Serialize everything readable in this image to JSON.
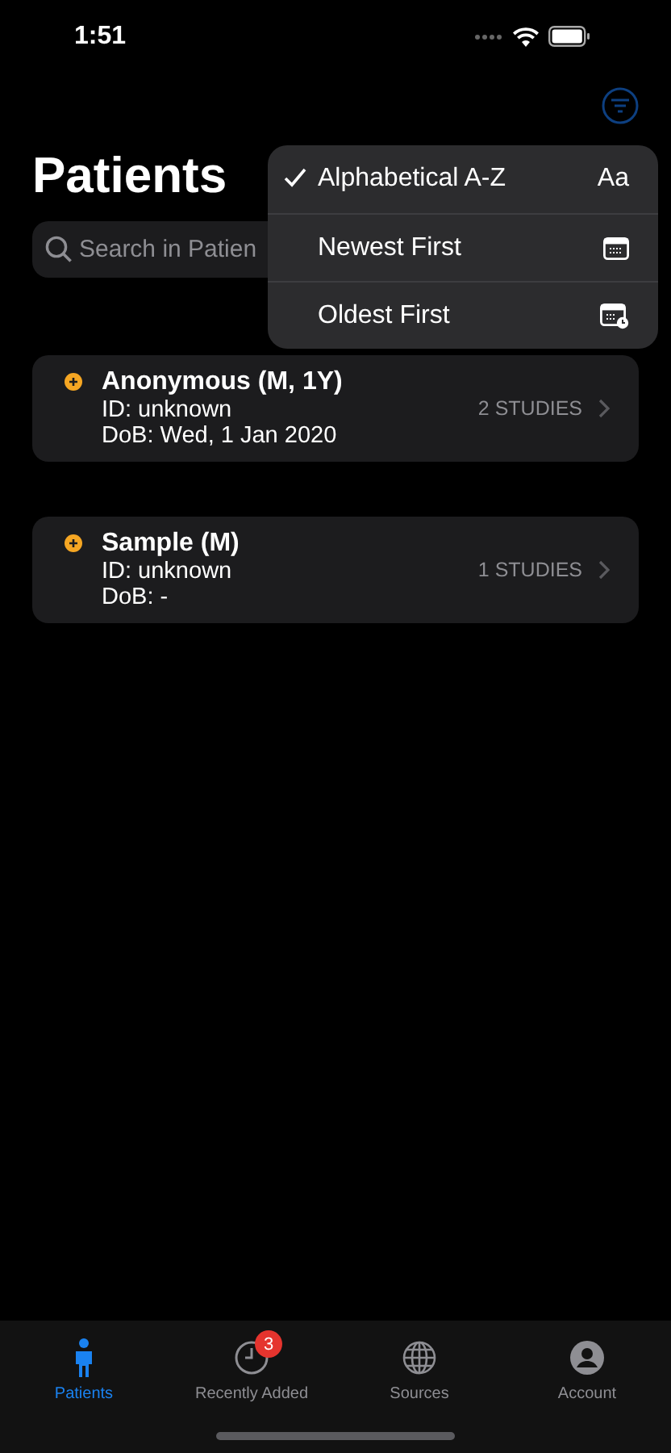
{
  "status_bar": {
    "time": "1:51"
  },
  "title": "Patients",
  "search": {
    "placeholder": "Search in Patien"
  },
  "sort_menu": [
    {
      "label": "Alphabetical A-Z",
      "selected": true,
      "kind": "text",
      "icon_text": "Aa"
    },
    {
      "label": "Newest First",
      "selected": false,
      "kind": "calendar"
    },
    {
      "label": "Oldest First",
      "selected": false,
      "kind": "calendar-clock"
    }
  ],
  "patients": [
    {
      "name": "Anonymous (M, 1Y)",
      "id": "ID: unknown",
      "dob": "DoB: Wed, 1 Jan 2020",
      "studies": "2 STUDIES"
    },
    {
      "name": "Sample (M)",
      "id": "ID: unknown",
      "dob": "DoB: -",
      "studies": "1 STUDIES"
    }
  ],
  "tabs": [
    {
      "label": "Patients",
      "selected": true,
      "kind": "person"
    },
    {
      "label": "Recently Added",
      "selected": false,
      "kind": "clock",
      "badge": "3"
    },
    {
      "label": "Sources",
      "selected": false,
      "kind": "globe"
    },
    {
      "label": "Account",
      "selected": false,
      "kind": "account"
    }
  ]
}
